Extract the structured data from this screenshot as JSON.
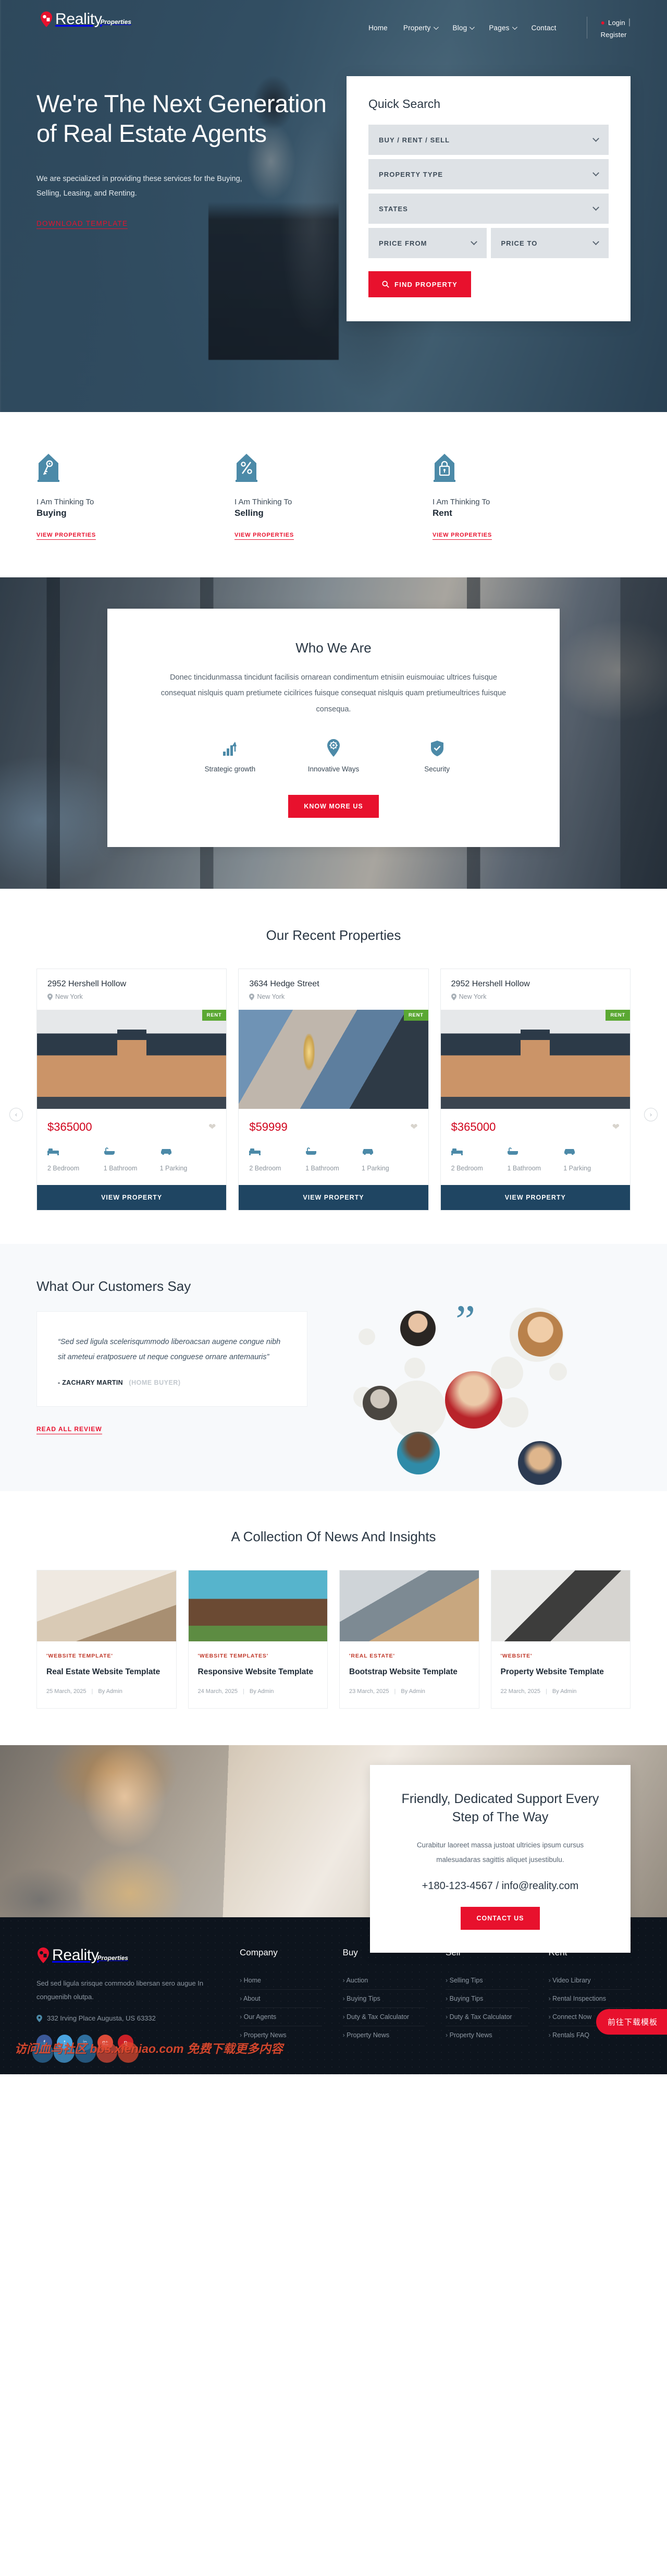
{
  "brand": {
    "name": "Reality",
    "sub": "Properties"
  },
  "nav": {
    "items": [
      {
        "label": "Home",
        "has_dropdown": false
      },
      {
        "label": "Property",
        "has_dropdown": true
      },
      {
        "label": "Blog",
        "has_dropdown": true
      },
      {
        "label": "Pages",
        "has_dropdown": true
      },
      {
        "label": "Contact",
        "has_dropdown": false
      }
    ],
    "login": "Login",
    "separator": "|",
    "register": "Register"
  },
  "hero": {
    "heading": "We're The Next Generation of Real Estate Agents",
    "subtext": "We are specialized in providing these services for the Buying, Selling, Leasing, and Renting.",
    "cta": "DOWNLOAD TEMPLATE"
  },
  "quick_search": {
    "title": "Quick Search",
    "fields": [
      {
        "label": "BUY / RENT / SELL"
      },
      {
        "label": "PROPERTY TYPE"
      },
      {
        "label": "STATES"
      }
    ],
    "price_from": "PRICE FROM",
    "price_to": "PRICE TO",
    "button": "FIND PROPERTY"
  },
  "services": [
    {
      "sub": "I Am Thinking To",
      "title": "Buying",
      "link": "VIEW PROPERTIES",
      "icon": "house-key-icon"
    },
    {
      "sub": "I Am Thinking To",
      "title": "Selling",
      "link": "VIEW PROPERTIES",
      "icon": "house-percent-icon"
    },
    {
      "sub": "I Am Thinking To",
      "title": "Rent",
      "link": "VIEW PROPERTIES",
      "icon": "house-lock-icon"
    }
  ],
  "who_we_are": {
    "title": "Who We Are",
    "body": "Donec tincidunmassa tincidunt facilisis ornarean condimentum etnisiin euismouiac ultrices fuisque consequat nislquis quam pretiumete cicilrices fuisque consequat nislquis quam pretiumeultrices fuisque consequa.",
    "features": [
      {
        "label": "Strategic growth",
        "icon": "bar-chart-arrow-icon"
      },
      {
        "label": "Innovative Ways",
        "icon": "gear-pin-icon"
      },
      {
        "label": "Security",
        "icon": "shield-check-icon"
      }
    ],
    "button": "KNOW MORE US"
  },
  "properties": {
    "title": "Our Recent Properties",
    "items": [
      {
        "name": "2952 Hershell Hollow",
        "location": "New York",
        "badge": "RENT",
        "price": "$365000",
        "bedroom": "2 Bedroom",
        "bathroom": "1 Bathroom",
        "parking": "1 Parking",
        "button": "VIEW PROPERTY"
      },
      {
        "name": "3634 Hedge Street",
        "location": "New York",
        "badge": "RENT",
        "price": "$59999",
        "bedroom": "2 Bedroom",
        "bathroom": "1 Bathroom",
        "parking": "1 Parking",
        "button": "VIEW PROPERTY"
      },
      {
        "name": "2952 Hershell Hollow",
        "location": "New York",
        "badge": "RENT",
        "price": "$365000",
        "bedroom": "2 Bedroom",
        "bathroom": "1 Bathroom",
        "parking": "1 Parking",
        "button": "VIEW PROPERTY"
      }
    ],
    "prev": "‹",
    "next": "›"
  },
  "testimonials": {
    "title": "What Our Customers Say",
    "quote": "“Sed sed ligula scelerisqummodo liberoacsan augene congue nibh sit ameteui eratposuere ut neque conguese ornare antemauris”",
    "author": "- ZACHARY MARTIN",
    "role": "(HOME BUYER)",
    "link": "READ ALL REVIEW"
  },
  "blog": {
    "title": "A Collection Of News And Insights",
    "posts": [
      {
        "category": "'WEBSITE TEMPLATE'",
        "title": "Real Estate Website Template",
        "date": "25 March, 2025",
        "author": "By Admin"
      },
      {
        "category": "'WEBSITE TEMPLATES'",
        "title": "Responsive Website Template",
        "date": "24 March, 2025",
        "author": "By Admin"
      },
      {
        "category": "'REAL ESTATE'",
        "title": "Bootstrap Website Template",
        "date": "23 March, 2025",
        "author": "By Admin"
      },
      {
        "category": "'WEBSITE'",
        "title": "Property Website Template",
        "date": "22 March, 2025",
        "author": "By Admin"
      }
    ],
    "meta_separator": "|"
  },
  "cta": {
    "heading": "Friendly, Dedicated Support Every Step of The Way",
    "body": "Curabitur laoreet massa justoat ultricies ipsum cursus malesuadaras sagittis aliquet jusestibulu.",
    "contact": "+180-123-4567 / info@reality.com",
    "button": "CONTACT US"
  },
  "footer": {
    "description": "Sed sed ligula srisque commodo libersan sero augue In conguenibh olutpa.",
    "address": "332 Irving Place Augusta, US 63332",
    "socials": [
      {
        "name": "facebook-icon",
        "glyph": "f",
        "color": "#3b5998"
      },
      {
        "name": "twitter-icon",
        "glyph": "t",
        "color": "#4aa3df"
      },
      {
        "name": "linkedin-icon",
        "glyph": "in",
        "color": "#2f6f9f"
      },
      {
        "name": "google-plus-icon",
        "glyph": "g+",
        "color": "#dd4b39"
      },
      {
        "name": "pinterest-icon",
        "glyph": "p",
        "color": "#cb2027"
      }
    ],
    "columns": [
      {
        "title": "Company",
        "links": [
          "Home",
          "About",
          "Our Agents",
          "Property News"
        ]
      },
      {
        "title": "Buy",
        "links": [
          "Auction",
          "Buying Tips",
          "Duty & Tax Calculator",
          "Property News"
        ]
      },
      {
        "title": "Sell",
        "links": [
          "Selling Tips",
          "Buying Tips",
          "Duty & Tax Calculator",
          "Property News"
        ]
      },
      {
        "title": "Rent",
        "links": [
          "Video Library",
          "Rental Inspections",
          "Connect Now",
          "Rentals FAQ"
        ]
      }
    ]
  },
  "overlay": {
    "watermark": "访问血鸟社区 bbs.xieniao.com 免费下载更多内容",
    "float_button": "前往下载模板"
  },
  "colors": {
    "accent_red": "#e8112d",
    "brand_blue": "#4c8aa8",
    "dark_blue": "#1f4562",
    "badge_green": "#5aa832",
    "footer_bg": "#0d141d"
  }
}
